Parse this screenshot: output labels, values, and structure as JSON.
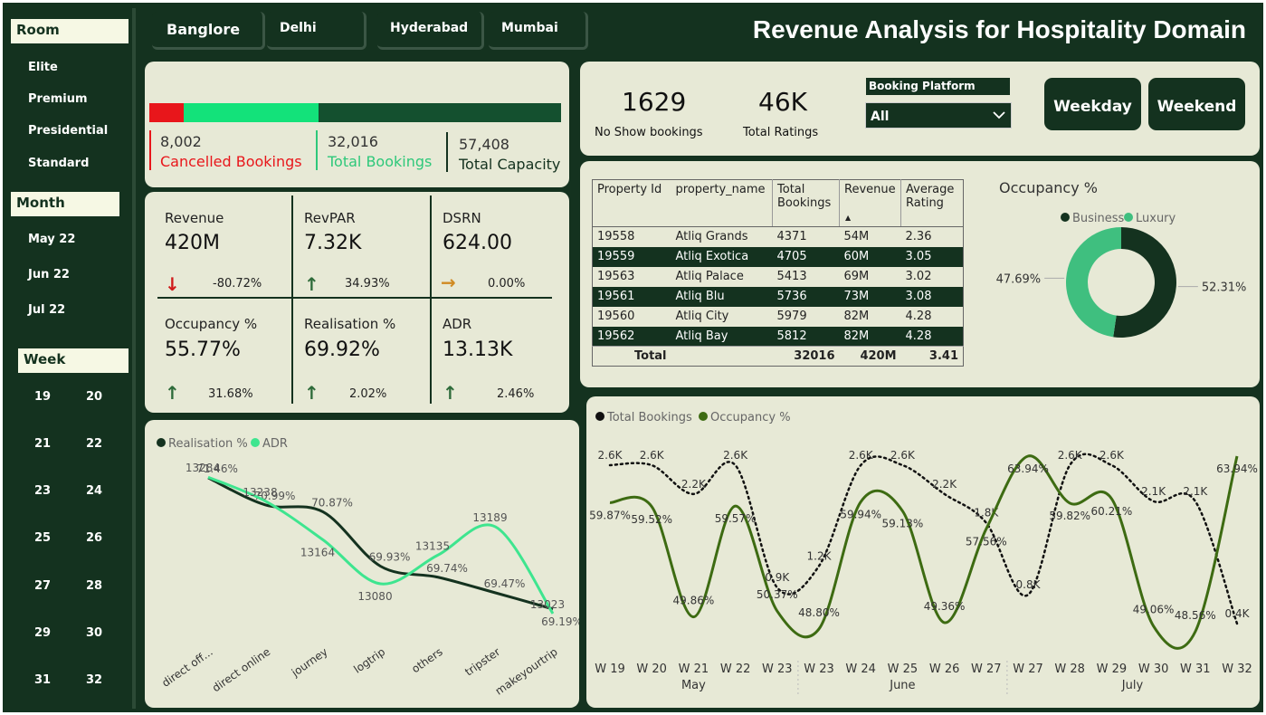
{
  "sidebar": {
    "room_label": "Room",
    "rooms": [
      "Elite",
      "Premium",
      "Presidential",
      "Standard"
    ],
    "month_label": "Month",
    "months": [
      "May 22",
      "Jun 22",
      "Jul 22"
    ],
    "week_label": "Week",
    "weeks": [
      "19",
      "20",
      "21",
      "22",
      "23",
      "24",
      "25",
      "26",
      "27",
      "28",
      "29",
      "30",
      "31",
      "32"
    ]
  },
  "cities": [
    "Banglore",
    "Delhi",
    "Hyderabad",
    "Mumbai"
  ],
  "title": "Revenue Analysis for Hospitality Domain",
  "bookings_bar": {
    "cancelled": "8,002",
    "cancelled_label": "Cancelled Bookings",
    "total": "32,016",
    "total_label": "Total Bookings",
    "capacity": "57,408",
    "capacity_label": "Total Capacity",
    "colors": {
      "cancelled": "#e8161b",
      "total": "#13e27a",
      "capacity": "#14502f"
    }
  },
  "kpis": [
    {
      "label": "Revenue",
      "value": "420M",
      "change": "-80.72%",
      "trend": "down"
    },
    {
      "label": "RevPAR",
      "value": "7.32K",
      "change": "34.93%",
      "trend": "up"
    },
    {
      "label": "DSRN",
      "value": "624.00",
      "change": "0.00%",
      "trend": "flat"
    },
    {
      "label": "Occupancy %",
      "value": "55.77%",
      "change": "31.68%",
      "trend": "up"
    },
    {
      "label": "Realisation %",
      "value": "69.92%",
      "change": "2.02%",
      "trend": "up"
    },
    {
      "label": "ADR",
      "value": "13.13K",
      "change": "2.46%",
      "trend": "up"
    }
  ],
  "top_stats": {
    "no_show_value": "1629",
    "no_show_label": "No Show bookings",
    "ratings_value": "46K",
    "ratings_label": "Total Ratings",
    "platform_label": "Booking Platform",
    "platform_selected": "All",
    "weekday": "Weekday",
    "weekend": "Weekend"
  },
  "property_table": {
    "headers": [
      "Property Id",
      "property_name",
      "Total Bookings",
      "Revenue",
      "Average Rating"
    ],
    "rows": [
      [
        "19558",
        "Atliq Grands",
        "4371",
        "54M",
        "2.36"
      ],
      [
        "19559",
        "Atliq Exotica",
        "4705",
        "60M",
        "3.05"
      ],
      [
        "19563",
        "Atliq Palace",
        "5413",
        "69M",
        "3.02"
      ],
      [
        "19561",
        "Atliq Blu",
        "5736",
        "73M",
        "3.08"
      ],
      [
        "19560",
        "Atliq City",
        "5979",
        "82M",
        "4.28"
      ],
      [
        "19562",
        "Atliq Bay",
        "5812",
        "82M",
        "4.28"
      ]
    ],
    "total": [
      "Total",
      "",
      "32016",
      "420M",
      "3.41"
    ]
  },
  "chart_data": [
    {
      "type": "pie",
      "title": "Occupancy %",
      "categories": [
        "Business",
        "Luxury"
      ],
      "values": [
        52.31,
        47.69
      ],
      "labels": [
        "52.31%",
        "47.69%"
      ],
      "colors": [
        "#14321f",
        "#3fbf7f"
      ],
      "legend": "top"
    },
    {
      "type": "line",
      "categories": [
        "direct off...",
        "direct online",
        "journey",
        "logtrip",
        "others",
        "tripster",
        "makeyourtrip"
      ],
      "series": [
        {
          "name": "Realisation %",
          "values": [
            71.46,
            70.99,
            70.87,
            69.93,
            69.74,
            69.47,
            69.19
          ],
          "labels": [
            "71.46%",
            "70.99%",
            "70.87%",
            "69.93%",
            "69.74%",
            "69.47%",
            "69.19%"
          ],
          "color": "#14321f"
        },
        {
          "name": "ADR",
          "values": [
            13284,
            13238,
            13164,
            13080,
            13135,
            13189,
            13023
          ],
          "labels": [
            "13284",
            "13238",
            "13164",
            "13080",
            "13135",
            "13189",
            "13023"
          ],
          "color": "#3ee58f"
        }
      ],
      "legend": "top-left"
    },
    {
      "type": "line",
      "categories": [
        "W 19",
        "W 20",
        "W 21",
        "W 22",
        "W 23",
        "W 23",
        "W 24",
        "W 25",
        "W 26",
        "W 27",
        "W 27",
        "W 28",
        "W 29",
        "W 30",
        "W 31",
        "W 32"
      ],
      "groups": [
        {
          "name": "May",
          "span": 5
        },
        {
          "name": "June",
          "span": 5
        },
        {
          "name": "July",
          "span": 6
        }
      ],
      "series": [
        {
          "name": "Total Bookings",
          "values": [
            2600,
            2600,
            2200,
            2600,
            900,
            1200,
            2600,
            2600,
            2200,
            1800,
            800,
            2600,
            2600,
            2100,
            2100,
            400
          ],
          "labels": [
            "2.6K",
            "2.6K",
            "2.2K",
            "2.6K",
            "0.9K",
            "1.2K",
            "2.6K",
            "2.6K",
            "2.2K",
            "1.8K",
            "0.8K",
            "2.6K",
            "2.6K",
            "2.1K",
            "2.1K",
            "0.4K"
          ],
          "color": "#111111",
          "style": "dotted"
        },
        {
          "name": "Occupancy %",
          "values": [
            59.87,
            59.52,
            49.86,
            59.57,
            50.37,
            48.8,
            59.94,
            59.13,
            49.36,
            57.56,
            63.94,
            59.82,
            60.21,
            49.06,
            48.56,
            63.94
          ],
          "labels": [
            "59.87%",
            "59.52%",
            "49.86%",
            "59.57%",
            "50.37%",
            "48.80%",
            "59.94%",
            "59.13%",
            "49.36%",
            "57.56%",
            "63.94%",
            "59.82%",
            "60.21%",
            "49.06%",
            "48.56%",
            "63.94%"
          ],
          "color": "#3d6b12"
        }
      ],
      "legend": "top-left"
    }
  ]
}
